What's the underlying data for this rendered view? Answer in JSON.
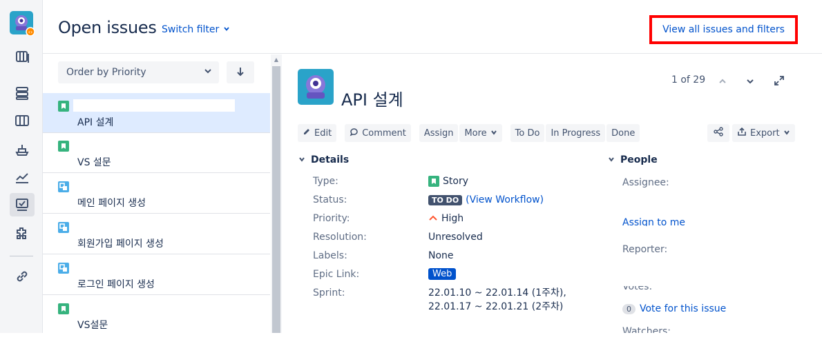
{
  "header": {
    "title": "Open issues",
    "switch_filter": "Switch filter",
    "view_all": "View all issues and filters"
  },
  "list": {
    "order_by": "Order by Priority",
    "issues": [
      {
        "summary": "API 설계",
        "type": "story",
        "selected": true
      },
      {
        "summary": "VS 설문",
        "type": "story",
        "selected": false
      },
      {
        "summary": "메인 페이지 생성",
        "type": "subtask",
        "selected": false
      },
      {
        "summary": "회원가입 페이지 생성",
        "type": "subtask",
        "selected": false
      },
      {
        "summary": "로그인 페이지 생성",
        "type": "subtask",
        "selected": false
      },
      {
        "summary": "VS설문",
        "type": "story",
        "selected": false
      }
    ]
  },
  "detail": {
    "title": "API 설계",
    "pager": "1 of 29",
    "toolbar": {
      "edit": "Edit",
      "comment": "Comment",
      "assign": "Assign",
      "more": "More",
      "todo": "To Do",
      "in_progress": "In Progress",
      "done": "Done",
      "export": "Export"
    },
    "details_heading": "Details",
    "people_heading": "People",
    "fields": {
      "type_label": "Type:",
      "type_value": "Story",
      "status_label": "Status:",
      "status_value": "TO DO",
      "view_workflow": "(View Workflow)",
      "priority_label": "Priority:",
      "priority_value": "High",
      "resolution_label": "Resolution:",
      "resolution_value": "Unresolved",
      "labels_label": "Labels:",
      "labels_value": "None",
      "epic_label": "Epic Link:",
      "epic_value": "Web",
      "sprint_label": "Sprint:",
      "sprint_value": "22.01.10 ~ 22.01.14 (1주차), 22.01.17 ~ 22.01.21 (2주차)"
    },
    "people": {
      "assignee_label": "Assignee:",
      "assign_to_me": "Assign to me",
      "reporter_label": "Reporter:",
      "votes_label": "Votes:",
      "vote_count": "0",
      "vote_link": "Vote for this issue",
      "watchers_label": "Watchers:"
    }
  },
  "colors": {
    "link": "#0052cc",
    "story": "#36b37e",
    "subtask": "#4bade8",
    "highlight": "#ff0000",
    "selected_row": "#deebff"
  }
}
